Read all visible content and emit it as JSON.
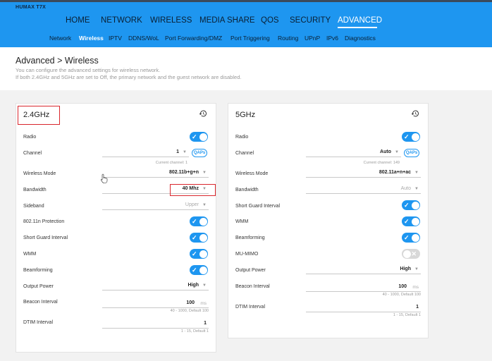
{
  "brand": "HUMAX T7X",
  "main_nav": [
    "HOME",
    "NETWORK",
    "WIRELESS",
    "MEDIA SHARE",
    "QOS",
    "SECURITY",
    "ADVANCED"
  ],
  "sub_nav": [
    "Network",
    "Wireless",
    "IPTV",
    "DDNS/WoL",
    "Port Forwarding/DMZ",
    "Port Triggering",
    "Routing",
    "UPnP",
    "IPv6",
    "Diagnostics"
  ],
  "page": {
    "title": "Advanced > Wireless",
    "desc1": "You can configure the advanced settings for wireless network.",
    "desc2": "If both 2.4GHz and 5GHz are set to Off, the primary network and the guest network are disabled."
  },
  "band24": {
    "title": "2.4GHz",
    "radio": "Radio",
    "channel": "Channel",
    "channel_value": "1",
    "channel_hint": "Current channel: 1",
    "aps": "APs",
    "mode": "Wireless Mode",
    "mode_value": "802.11b+g+n",
    "bandwidth": "Bandwidth",
    "bandwidth_value": "40 Mhz",
    "sideband": "Sideband",
    "sideband_value": "Upper",
    "protection": "802.11n Protection",
    "sgi": "Short Guard Interval",
    "wmm": "WMM",
    "beamforming": "Beamforming",
    "power": "Output Power",
    "power_value": "High",
    "beacon": "Beacon Interval",
    "beacon_value": "100",
    "beacon_unit": "ms",
    "beacon_hint": "40 - 1000, Default 100",
    "dtim": "DTIM Interval",
    "dtim_value": "1",
    "dtim_hint": "1 - 15, Default 1"
  },
  "band5": {
    "title": "5GHz",
    "radio": "Radio",
    "channel": "Channel",
    "channel_value": "Auto",
    "channel_hint": "Current channel: 149",
    "aps": "APs",
    "mode": "Wireless Mode",
    "mode_value": "802.11a+n+ac",
    "bandwidth": "Bandwidth",
    "bandwidth_value": "Auto",
    "sgi": "Short Guard Interval",
    "wmm": "WMM",
    "beamforming": "Beamforming",
    "mumimo": "MU-MIMO",
    "power": "Output Power",
    "power_value": "High",
    "beacon": "Beacon Interval",
    "beacon_value": "100",
    "beacon_unit": "ms",
    "beacon_hint": "40 - 1000, Default 100",
    "dtim": "DTIM Interval",
    "dtim_value": "1",
    "dtim_hint": "1 - 15, Default 1"
  },
  "colors": {
    "accent": "#1e96f0",
    "highlight": "#d9262c",
    "toggle_off": "#d8d8d8"
  },
  "icons": {
    "reset": "history-icon",
    "select": "chevron-down-icon",
    "toggle_on": "check-icon",
    "toggle_off": "x-icon",
    "cursor": "hand-pointer-icon"
  }
}
